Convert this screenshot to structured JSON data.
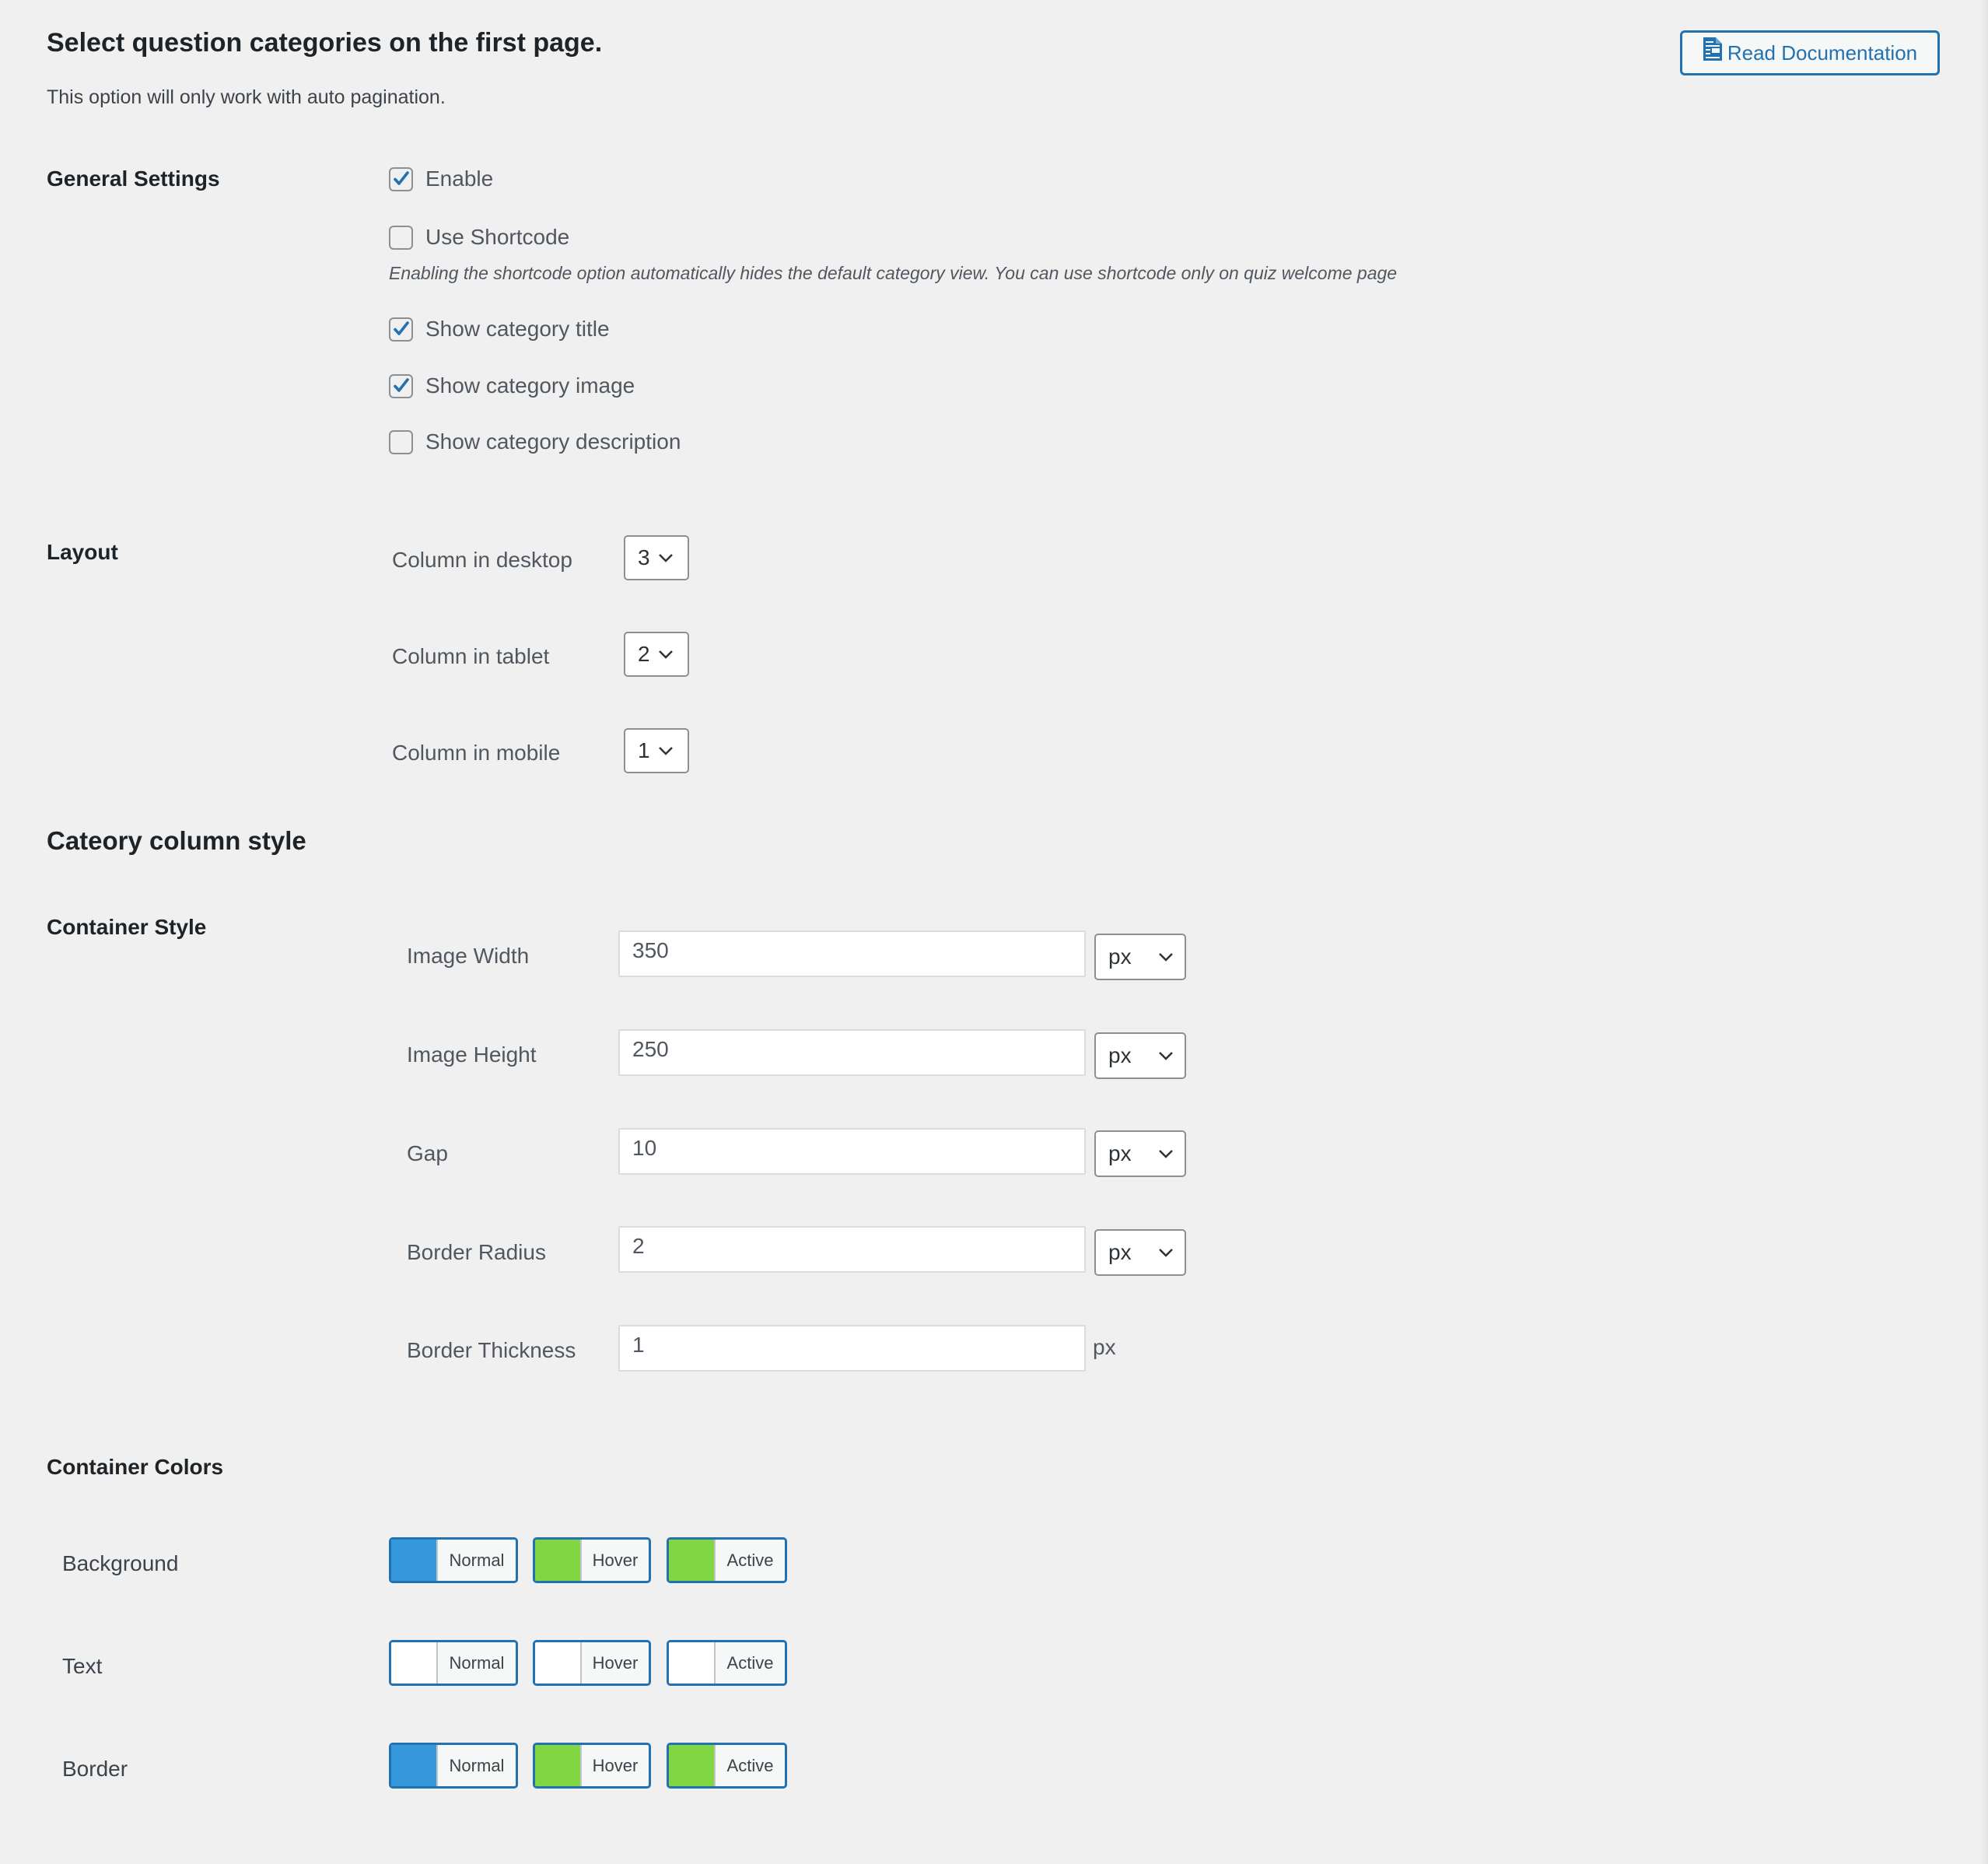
{
  "header": {
    "title": "Select question categories on the first page.",
    "description": "This option will only work with auto pagination.",
    "doc_button_label": "Read Documentation",
    "doc_icon": "document-icon"
  },
  "general": {
    "label": "General Settings",
    "options": [
      {
        "label": "Enable",
        "checked": true
      },
      {
        "label": "Use Shortcode",
        "checked": false
      },
      {
        "label": "Show category title",
        "checked": true
      },
      {
        "label": "Show category image",
        "checked": true
      },
      {
        "label": "Show category description",
        "checked": false
      }
    ],
    "shortcode_help": "Enabling the shortcode option automatically hides the default category view. You can use shortcode only on quiz welcome page"
  },
  "layout": {
    "label": "Layout",
    "rows": [
      {
        "label": "Column in desktop",
        "value": "3"
      },
      {
        "label": "Column in tablet",
        "value": "2"
      },
      {
        "label": "Column in mobile",
        "value": "1"
      }
    ]
  },
  "column_style": {
    "heading": "Cateory column style",
    "container_style_label": "Container Style",
    "fields": [
      {
        "label": "Image Width",
        "value": "350",
        "unit": "px",
        "unit_is_select": true
      },
      {
        "label": "Image Height",
        "value": "250",
        "unit": "px",
        "unit_is_select": true
      },
      {
        "label": "Gap",
        "value": "10",
        "unit": "px",
        "unit_is_select": true
      },
      {
        "label": "Border Radius",
        "value": "2",
        "unit": "px",
        "unit_is_select": true
      },
      {
        "label": "Border Thickness",
        "value": "1",
        "unit": "px",
        "unit_is_select": false
      }
    ]
  },
  "colors": {
    "label": "Container Colors",
    "rows": [
      {
        "label": "Background",
        "states": [
          {
            "label": "Normal",
            "color": "#3498db"
          },
          {
            "label": "Hover",
            "color": "#81d742"
          },
          {
            "label": "Active",
            "color": "#81d742"
          }
        ]
      },
      {
        "label": "Text",
        "states": [
          {
            "label": "Normal",
            "color": "#ffffff"
          },
          {
            "label": "Hover",
            "color": "#ffffff"
          },
          {
            "label": "Active",
            "color": "#ffffff"
          }
        ]
      },
      {
        "label": "Border",
        "states": [
          {
            "label": "Normal",
            "color": "#3498db"
          },
          {
            "label": "Hover",
            "color": "#81d742"
          },
          {
            "label": "Active",
            "color": "#81d742"
          }
        ]
      }
    ]
  },
  "theme": {
    "accent": "#2271b1",
    "background": "#f0f0f1"
  }
}
